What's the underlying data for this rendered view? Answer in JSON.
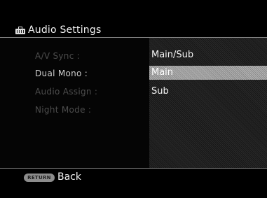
{
  "header": {
    "title": "Audio Settings",
    "icon": "toolbox-icon"
  },
  "menu": {
    "items": [
      {
        "label": "A/V Sync :",
        "state": "dim"
      },
      {
        "label": "Dual Mono :",
        "state": "active"
      },
      {
        "label": "Audio Assign :",
        "state": "dim"
      },
      {
        "label": "Night Mode :",
        "state": "dim"
      }
    ]
  },
  "options": {
    "items": [
      {
        "label": "Main/Sub",
        "selected": false
      },
      {
        "label": "Main",
        "selected": true
      },
      {
        "label": "Sub",
        "selected": false
      }
    ]
  },
  "footer": {
    "return_key": "RETURN",
    "back_label": "Back"
  }
}
